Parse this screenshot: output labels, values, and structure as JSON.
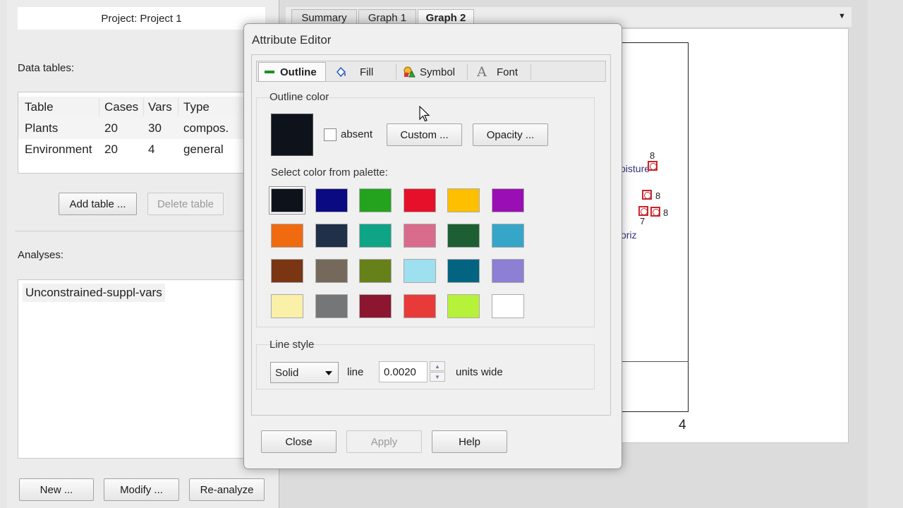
{
  "left_panel": {
    "project_title": "Project: Project 1",
    "data_tables_label": "Data tables:",
    "table_columns": [
      "Table",
      "Cases",
      "Vars",
      "Type"
    ],
    "table_rows": [
      {
        "table": "Plants",
        "cases": "20",
        "vars": "30",
        "type": "compos."
      },
      {
        "table": "Environment",
        "cases": "20",
        "vars": "4",
        "type": "general"
      }
    ],
    "add_table_button": "Add table ...",
    "delete_table_button": "Delete table",
    "analyses_label": "Analyses:",
    "analysis_items": [
      "Unconstrained-suppl-vars"
    ],
    "new_button": "New ...",
    "modify_button": "Modify ...",
    "reanalyze_button": "Re-analyze"
  },
  "graph_area": {
    "tabs": [
      {
        "label": "Summary",
        "active": false
      },
      {
        "label": "Graph 1",
        "active": false
      },
      {
        "label": "Graph 2",
        "active": true
      }
    ],
    "dropdown_icon": "triangle-down",
    "plot_labels": [
      "oisture",
      "oriz"
    ],
    "marker_labels": [
      "8",
      "8",
      "8",
      "7"
    ],
    "axis_tick": "4"
  },
  "dialog": {
    "title": "Attribute Editor",
    "tabs": [
      {
        "label": "Outline",
        "icon": "outline-line-icon",
        "active": true
      },
      {
        "label": "Fill",
        "icon": "paint-bucket-icon",
        "active": false
      },
      {
        "label": "Symbol",
        "icon": "shapes-icon",
        "active": false
      },
      {
        "label": "Font",
        "icon": "font-a-icon",
        "active": false
      }
    ],
    "outline_color_group": "Outline color",
    "current_color": "#0e131b",
    "absent_label": "absent",
    "absent_checked": false,
    "custom_button": "Custom ...",
    "opacity_button": "Opacity ...",
    "palette_label": "Select color from palette:",
    "palette": [
      [
        "#0e131b",
        "#0a0a82",
        "#23a31e",
        "#e6102a",
        "#fdbf00",
        "#9a0fb5"
      ],
      [
        "#f06a0f",
        "#1f3048",
        "#0ea586",
        "#d96b8c",
        "#1e5e33",
        "#36a6c8"
      ],
      [
        "#7a3512",
        "#75695b",
        "#668119",
        "#9ee0f0",
        "#036482",
        "#8c7fd4"
      ],
      [
        "#fbf0a8",
        "#747678",
        "#8c1530",
        "#e83a39",
        "#b7f23a",
        "#ffffff"
      ]
    ],
    "selected_swatch": "#0e131b",
    "line_style_group": "Line style",
    "line_style_value": "Solid",
    "line_label": "line",
    "width_value": "0.0020",
    "units_label": "units wide",
    "close_button": "Close",
    "apply_button": "Apply",
    "help_button": "Help"
  }
}
